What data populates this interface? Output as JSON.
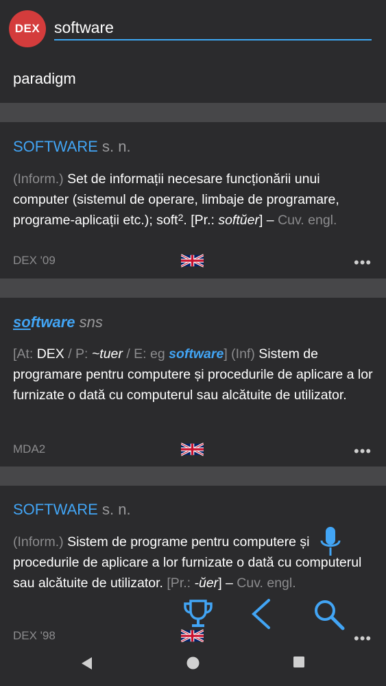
{
  "app": {
    "logo_text": "DEX",
    "search_query": "software",
    "suggestion": "paradigm"
  },
  "entries": [
    {
      "headword": "SOFTWARE",
      "grammar": "s. n.",
      "tag": "(Inform.)",
      "definition_a": "Set de informații necesare funcționării unui computer (sistemul de operare, limbaje de programare, programe-aplicații etc.); soft",
      "superscript": "2",
      "pr_open": ". [Pr.: ",
      "pronunciation": "softŭer",
      "pr_close": "] – ",
      "etymology": "Cuv. engl.",
      "source": "DEX '09",
      "flag": "uk-flag-icon"
    },
    {
      "headword_prefix": "so",
      "headword_rest": "ftware",
      "grammar": "sns",
      "at_label": "[At:",
      "at_value": "DEX",
      "p_label": "/ P:",
      "p_value": "~tuer",
      "e_label": "/ E: eg",
      "e_value": "software",
      "e_close": "] (Inf)",
      "definition": "Sistem de programare pentru computere și procedurile de aplicare a lor furnizate o dată cu computerul sau alcătuite de utilizator.",
      "source": "MDA2",
      "flag": "uk-flag-icon"
    },
    {
      "headword": "SOFTWARE",
      "grammar": "s. n.",
      "tag": "(Inform.)",
      "definition": "Sistem de programe pentru computere și procedurile de aplicare a lor furnizate o dată cu computerul sau alcătuite de utilizator.",
      "pr_open": "[Pr.:",
      "pronunciation": "-ŭer",
      "pr_close": "] –",
      "etymology": "Cuv. engl.",
      "source": "DEX '98",
      "flag": "uk-flag-icon"
    }
  ],
  "more_label": "•••",
  "colors": {
    "accent": "#42a5f5",
    "background": "#2b2b2d",
    "separator": "#474749",
    "logo": "#d43c3c"
  },
  "fabs": [
    "microphone-icon",
    "trophy-icon",
    "back-chevron-icon",
    "search-icon"
  ],
  "navbar": [
    "nav-back-icon",
    "nav-home-icon",
    "nav-recents-icon"
  ]
}
